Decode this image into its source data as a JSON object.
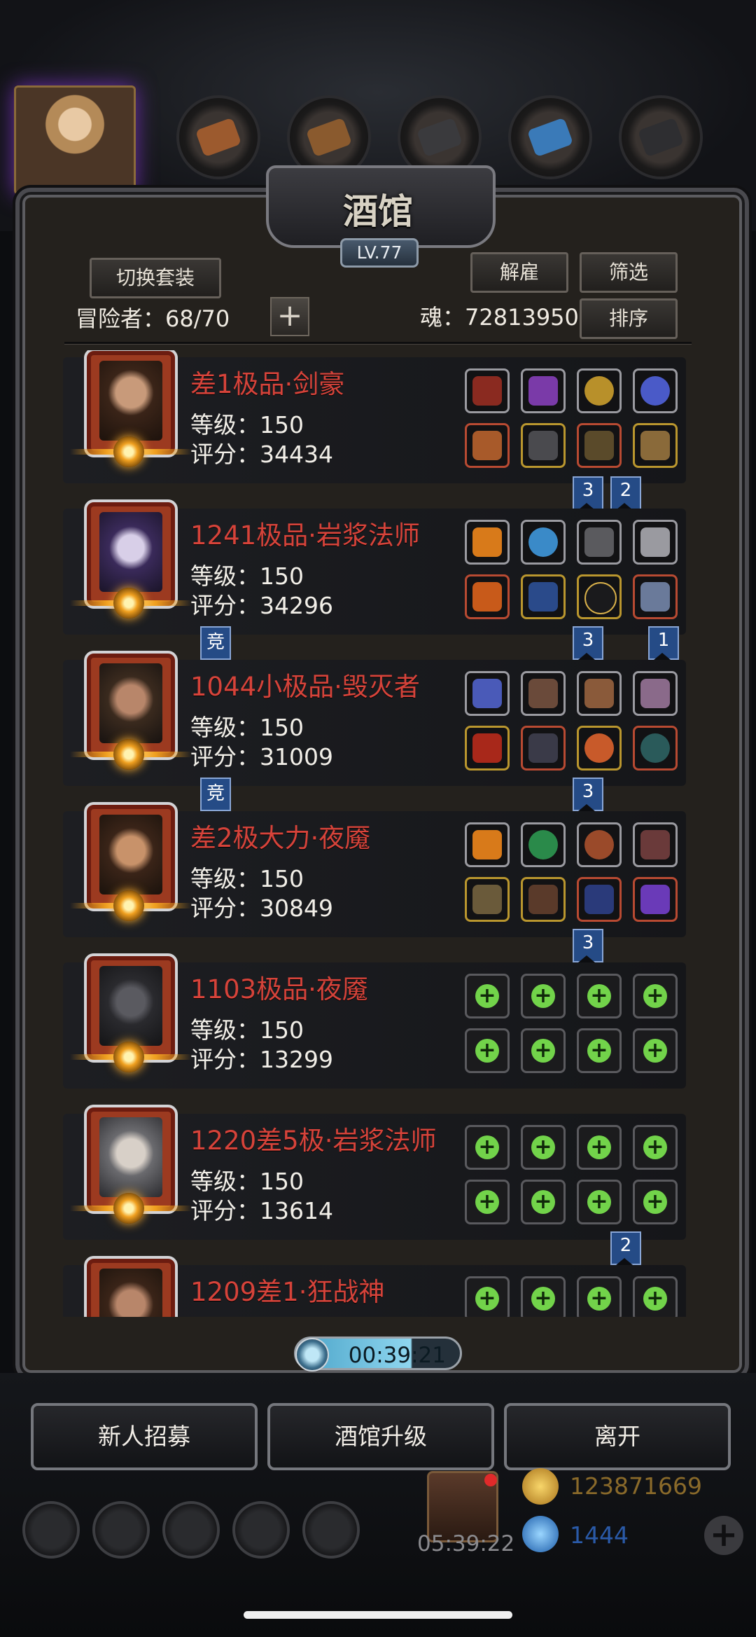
{
  "header": {
    "title": "酒馆",
    "level": "LV.77",
    "switch_outfit": "切换套装",
    "dismiss": "解雇",
    "filter": "筛选",
    "sort": "排序",
    "adventurers_label": "冒险者：",
    "adventurers_count": "68/70",
    "soul_label": "魂：",
    "soul_value": "72813950"
  },
  "heroes": [
    {
      "name": "差1极品·剑豪",
      "level": "等级：150",
      "score": "评分：34434",
      "tags": [
        "3",
        "2"
      ],
      "competitive": false
    },
    {
      "name": "1241极品·岩浆法师",
      "level": "等级：150",
      "score": "评分：34296",
      "tags": [
        "3",
        "1"
      ],
      "competitive": true
    },
    {
      "name": "1044小极品·毁灭者",
      "level": "等级：150",
      "score": "评分：31009",
      "tags": [
        "3"
      ],
      "competitive": true
    },
    {
      "name": "差2极大力·夜魇",
      "level": "等级：150",
      "score": "评分：30849",
      "tags": [
        "3"
      ],
      "competitive": false
    },
    {
      "name": "1103极品·夜魇",
      "level": "等级：150",
      "score": "评分：13299",
      "tags": [],
      "competitive": false
    },
    {
      "name": "1220差5极·岩浆法师",
      "level": "等级：150",
      "score": "评分：13614",
      "tags": [
        "2"
      ],
      "competitive": false
    },
    {
      "name": "1209差1·狂战神",
      "level": "",
      "score": "",
      "tags": [],
      "competitive": false
    }
  ],
  "competitive_label": "竞",
  "timer": "00:39:21",
  "actions": {
    "recruit": "新人招募",
    "upgrade": "酒馆升级",
    "leave": "离开"
  },
  "footer": {
    "gift_timer": "05:39:22",
    "gold": "123871669",
    "gems": "1444"
  },
  "colors": {
    "hero_name": "#d6433a",
    "accent_green": "#72d34a",
    "tag_blue": "#254b86"
  }
}
